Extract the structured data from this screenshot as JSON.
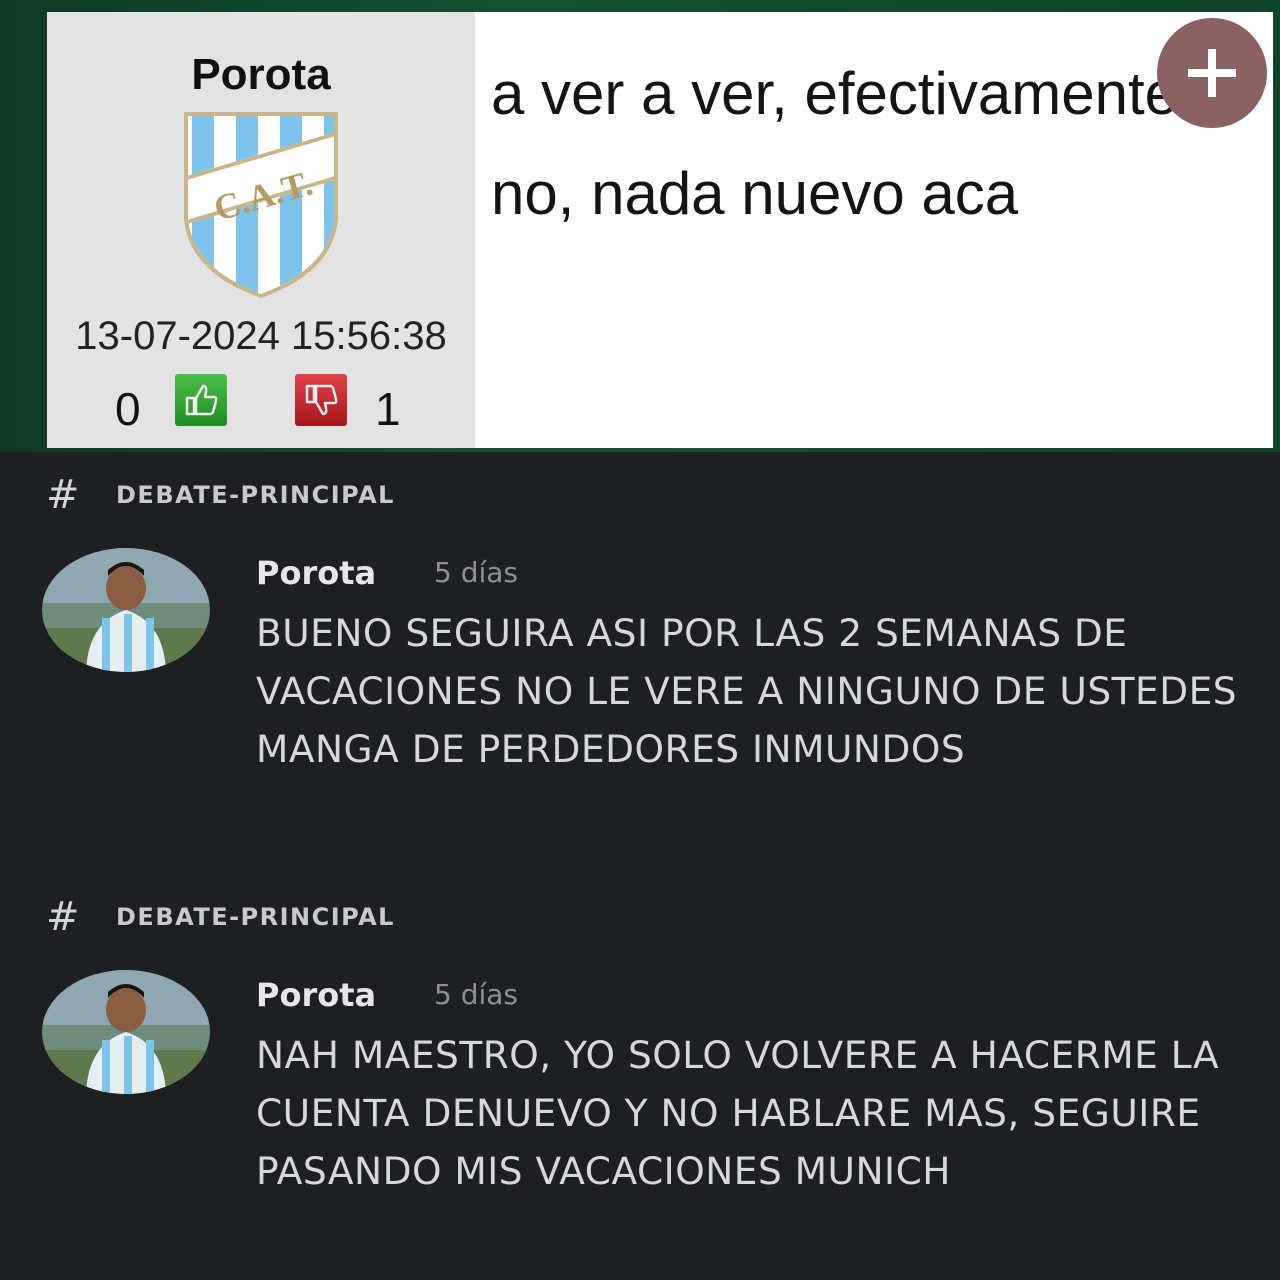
{
  "post": {
    "username": "Porota",
    "crest_text": "C.A.T.",
    "date": "13-07-2024 15:56:38",
    "likes": "0",
    "dislikes": "1",
    "text": "a ver a ver, efectivamente no, nada nuevo aca",
    "icons": {
      "crest": "club-crest-icon",
      "like": "thumbs-up-icon",
      "dislike": "thumbs-down-icon",
      "add": "plus-icon"
    },
    "colors": {
      "like": "#2a9a2c",
      "dislike": "#c0202a",
      "plus_button": "#8a6261"
    }
  },
  "chat": {
    "messages": [
      {
        "channel_icon": "#",
        "channel": "DEBATE-PRINCIPAL",
        "user": "Porota",
        "time": "5 días",
        "text": "BUENO SEGUIRA ASI POR LAS 2 SEMANAS DE VACACIONES NO LE VERE A NINGUNO DE USTEDES MANGA DE PERDEDORES INMUNDOS"
      },
      {
        "channel_icon": "#",
        "channel": "DEBATE-PRINCIPAL",
        "user": "Porota",
        "time": "5 días",
        "text": "NAH MAESTRO, YO SOLO VOLVERE A HACERME LA CUENTA DENUEVO Y NO HABLARE MAS, SEGUIRE PASANDO MIS VACACIONES MUNICH"
      }
    ]
  }
}
